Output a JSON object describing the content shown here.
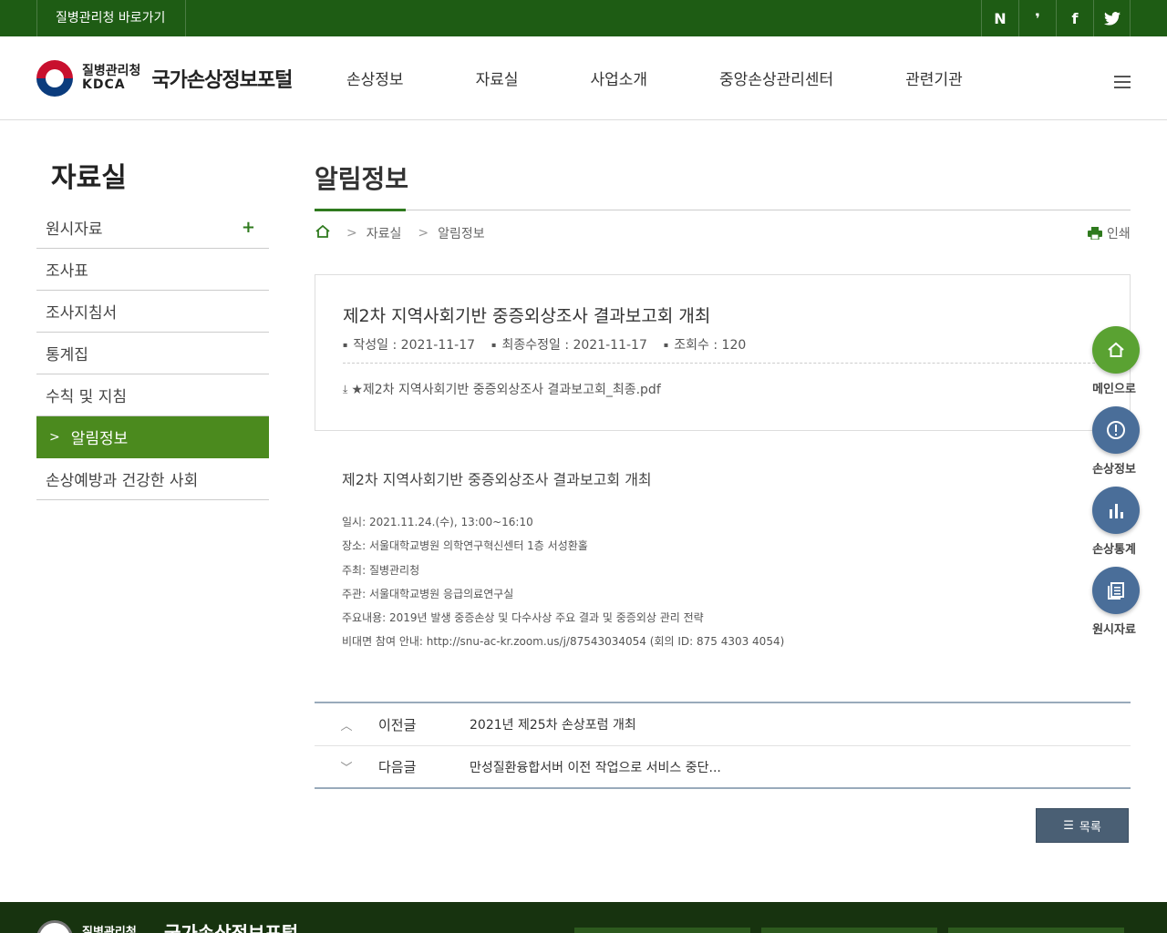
{
  "topbar": {
    "kdca_link": "질병관리청 바로가기",
    "social": [
      {
        "name": "naver-blog-icon",
        "glyph": "N"
      },
      {
        "name": "kakao-story-icon",
        "glyph": "❜"
      },
      {
        "name": "facebook-icon",
        "glyph": "f"
      },
      {
        "name": "twitter-icon",
        "glyph": "🐦"
      }
    ]
  },
  "header": {
    "org_ko": "질병관리청",
    "org_en": "KDCA",
    "site_name": "국가손상정보포털",
    "gnb": [
      "손상정보",
      "자료실",
      "사업소개",
      "중앙손상관리센터",
      "관련기관"
    ]
  },
  "side": {
    "title": "자료실",
    "items": [
      {
        "label": "원시자료",
        "expandable": true
      },
      {
        "label": "조사표"
      },
      {
        "label": "조사지침서"
      },
      {
        "label": "통계집"
      },
      {
        "label": "수칙 및 지침"
      },
      {
        "label": "알림정보",
        "active": true
      },
      {
        "label": "손상예방과 건강한 사회"
      }
    ]
  },
  "content": {
    "page_title": "알림정보",
    "breadcrumb": [
      "자료실",
      "알림정보"
    ],
    "print_label": "인쇄",
    "post": {
      "title": "제2차 지역사회기반 중증외상조사 결과보고회 개최",
      "meta": [
        "작성일 : 2021-11-17",
        "최종수정일 : 2021-11-17",
        "조회수 : 120"
      ],
      "attachment": "★제2차 지역사회기반 중증외상조사 결과보고회_최종.pdf"
    },
    "body_title": "제2차 지역사회기반 중증외상조사 결과보고회 개최",
    "body_lines": [
      "일시: 2021.11.24.(수), 13:00~16:10",
      "장소: 서울대학교병원 의학연구혁신센터 1층 서성환홀",
      "주최: 질병관리청",
      "주관: 서울대학교병원 응급의료연구실",
      "주요내용: 2019년 발생 중증손상 및 다수사상 주요 결과 및 중증외상 관리 전략",
      "비대면 참여 안내: http://snu-ac-kr.zoom.us/j/87543034054 (회의 ID: 875 4303 4054)"
    ],
    "prev": {
      "label": "이전글",
      "title": "2021년 제25차 손상포럼 개최"
    },
    "next": {
      "label": "다음글",
      "title": "만성질환융합서버 이전 작업으로 서비스 중단..."
    },
    "list_button": "목록"
  },
  "quick": [
    {
      "label": "메인으로",
      "icon": "home-icon",
      "color": "#5aa232"
    },
    {
      "label": "손상정보",
      "icon": "alert-icon",
      "color": "#4a6e99"
    },
    {
      "label": "손상통계",
      "icon": "bar-chart-icon",
      "color": "#4a6e99"
    },
    {
      "label": "원시자료",
      "icon": "document-icon",
      "color": "#4a6e99"
    }
  ],
  "footer": {
    "org_ko": "질병관리청",
    "site_name": "국가손상정보포털"
  }
}
